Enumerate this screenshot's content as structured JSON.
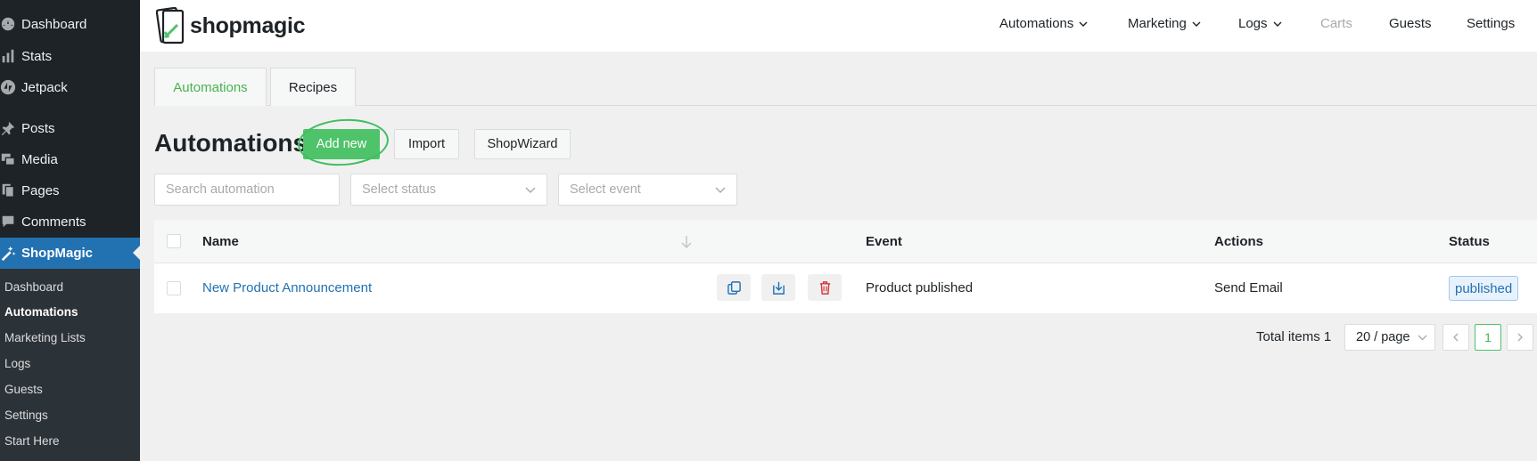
{
  "sidebar": {
    "items": [
      {
        "label": "Dashboard",
        "icon": "dashboard-icon"
      },
      {
        "label": "Stats",
        "icon": "stats-icon"
      },
      {
        "label": "Jetpack",
        "icon": "jetpack-icon"
      },
      {
        "label": "Posts",
        "icon": "pin-icon"
      },
      {
        "label": "Media",
        "icon": "media-icon"
      },
      {
        "label": "Pages",
        "icon": "pages-icon"
      },
      {
        "label": "Comments",
        "icon": "comment-icon"
      },
      {
        "label": "ShopMagic",
        "icon": "magic-wand-icon"
      }
    ],
    "submenu": [
      "Dashboard",
      "Automations",
      "Marketing Lists",
      "Logs",
      "Guests",
      "Settings",
      "Start Here"
    ],
    "current_submenu": "Automations"
  },
  "brand": {
    "name": "shopmagic"
  },
  "topnav": [
    {
      "label": "Automations",
      "dropdown": true
    },
    {
      "label": "Marketing",
      "dropdown": true
    },
    {
      "label": "Logs",
      "dropdown": true
    },
    {
      "label": "Carts",
      "dropdown": false
    },
    {
      "label": "Guests",
      "dropdown": false
    },
    {
      "label": "Settings",
      "dropdown": false
    }
  ],
  "tabs": [
    {
      "label": "Automations",
      "active": true
    },
    {
      "label": "Recipes",
      "active": false
    }
  ],
  "page": {
    "title": "Automations",
    "add_new": "Add new",
    "import": "Import",
    "shopwizard": "ShopWizard"
  },
  "filters": {
    "search_placeholder": "Search automation",
    "status_placeholder": "Select status",
    "event_placeholder": "Select event"
  },
  "table": {
    "headers": {
      "name": "Name",
      "event": "Event",
      "actions": "Actions",
      "status": "Status"
    },
    "rows": [
      {
        "name": "New Product Announcement",
        "event": "Product published",
        "actions": "Send Email",
        "status": "published"
      }
    ]
  },
  "pagination": {
    "total": "Total items 1",
    "page_size": "20 / page",
    "current_page": "1"
  },
  "colors": {
    "sidebar_bg": "#1d2327",
    "active_menu": "#2271b1",
    "brand_green": "#4fc36a",
    "link_blue": "#2271b1",
    "delete_red": "#d63638"
  }
}
